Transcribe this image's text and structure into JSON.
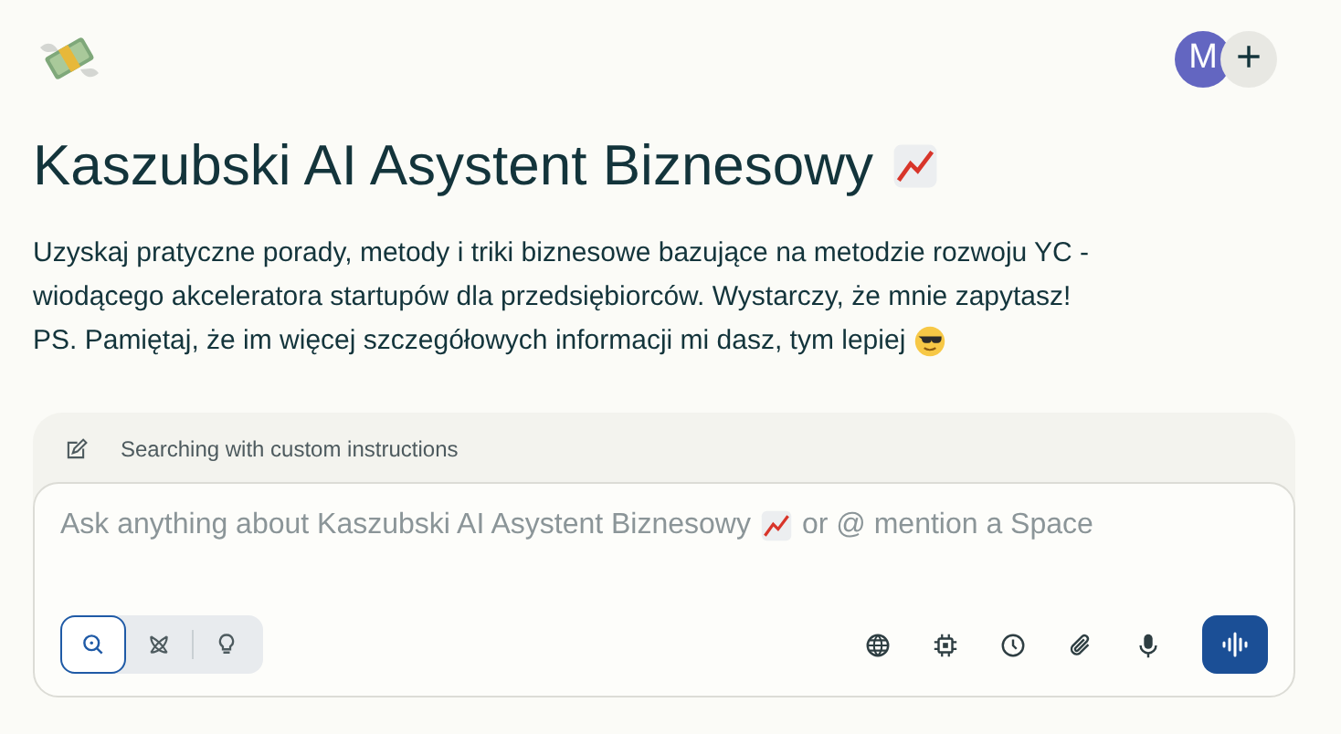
{
  "header": {
    "avatar_initial": "M",
    "add_button": "+"
  },
  "title": "Kaszubski AI Asystent Biznesowy",
  "description": "Uzyskaj pratyczne porady, metody i triki biznesowe bazujące na metodzie rozwoju YC - wiodącego akceleratora startupów dla przedsiębiorców. Wystarczy, że mnie zapytasz!\nPS. Pamiętaj, że im więcej szczegółowych informacji mi dasz, tym lepiej",
  "composer": {
    "instructions_note": "Searching with custom instructions",
    "placeholder_start": "Ask anything about Kaszubski AI Asystent Biznesowy",
    "placeholder_end": "or @ mention a Space",
    "modes": [
      {
        "kind": "search",
        "selected": true
      },
      {
        "kind": "research",
        "selected": false
      },
      {
        "kind": "labs",
        "selected": false
      }
    ],
    "tools": [
      {
        "kind": "globe"
      },
      {
        "kind": "chip"
      },
      {
        "kind": "clock"
      },
      {
        "kind": "attach"
      },
      {
        "kind": "mic"
      }
    ]
  }
}
